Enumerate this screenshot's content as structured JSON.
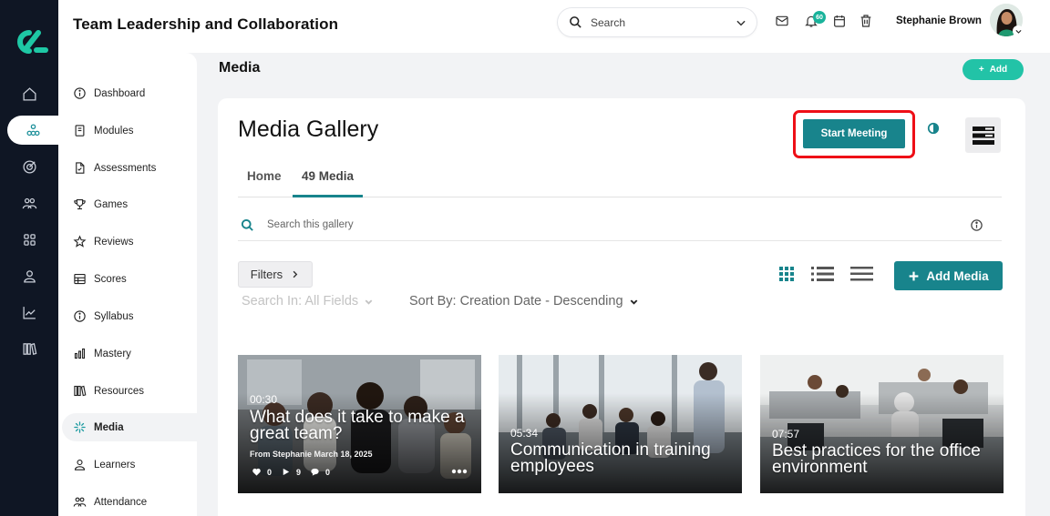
{
  "app": {
    "title": "Team Leadership and Collaboration"
  },
  "topbar": {
    "search_placeholder": "Search",
    "notification_count": "60",
    "user_name": "Stephanie Brown"
  },
  "rail": {
    "items": [
      "home-icon",
      "modules-network-icon",
      "target-icon",
      "people-icon",
      "grid-icon",
      "user-icon",
      "chart-line-icon",
      "library-icon"
    ]
  },
  "sidebar": {
    "items": [
      {
        "label": "Dashboard",
        "icon": "info-circle-icon"
      },
      {
        "label": "Modules",
        "icon": "book-icon"
      },
      {
        "label": "Assessments",
        "icon": "document-icon"
      },
      {
        "label": "Games",
        "icon": "trophy-icon"
      },
      {
        "label": "Reviews",
        "icon": "star-icon"
      },
      {
        "label": "Scores",
        "icon": "table-icon"
      },
      {
        "label": "Syllabus",
        "icon": "info-circle-icon"
      },
      {
        "label": "Mastery",
        "icon": "bars-icon"
      },
      {
        "label": "Resources",
        "icon": "books-icon"
      },
      {
        "label": "Media",
        "icon": "sparkle-icon",
        "active": true
      },
      {
        "label": "Learners",
        "icon": "user-icon"
      },
      {
        "label": "Attendance",
        "icon": "group-icon"
      }
    ]
  },
  "page": {
    "title": "Media",
    "add_label": "Add"
  },
  "gallery": {
    "title": "Media Gallery",
    "start_meeting_label": "Start Meeting",
    "tabs": [
      {
        "label": "Home",
        "active": false
      },
      {
        "label": "49 Media",
        "active": true
      }
    ],
    "search_placeholder": "Search this gallery",
    "filters_label": "Filters",
    "add_media_label": "Add Media",
    "search_in_label": "Search In: All Fields",
    "sort_by_label": "Sort By: Creation Date - Descending",
    "accent_color": "#18848c",
    "highlight_color": "#ee0f17"
  },
  "media": [
    {
      "duration": "00:30",
      "title": "What does it take to make a great team?",
      "meta": "From Stephanie March 18, 2025",
      "likes": "0",
      "plays": "9",
      "comments": "0"
    },
    {
      "duration": "05:34",
      "title": "Communication in training employees"
    },
    {
      "duration": "07:57",
      "title": "Best practices for the office environment"
    }
  ]
}
